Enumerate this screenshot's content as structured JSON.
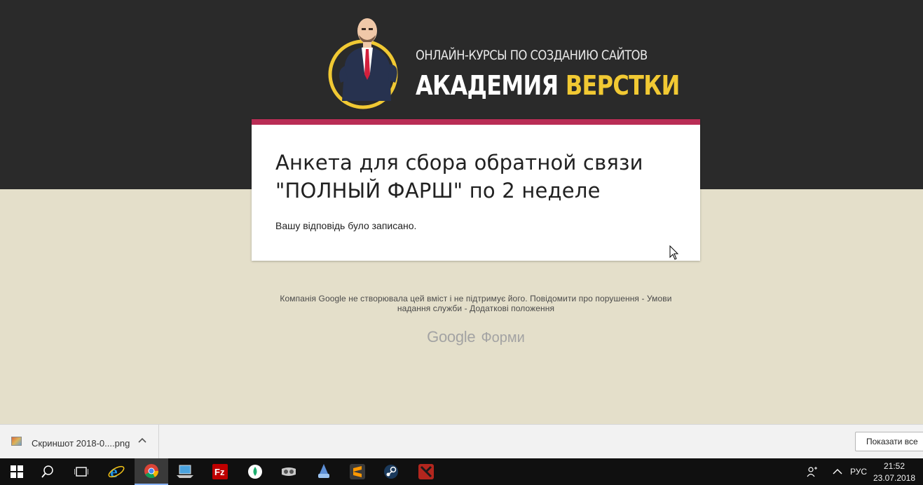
{
  "header": {
    "logo_subtitle": "ОНЛАЙН-КУРСЫ ПО СОЗДАНИЮ САЙТОВ",
    "logo_title_part1": "АКАДЕМИЯ",
    "logo_title_part2": "ВЕРСТКИ",
    "logo_accent_color": "#f1c933"
  },
  "form_card": {
    "title": "Анкета для сбора обратной связи \"ПОЛНЫЙ ФАРШ\" по 2 неделе",
    "confirmation": "Вашу відповідь було записано.",
    "accent_color": "#b92d55"
  },
  "footer": {
    "disclaimer": "Компанія Google не створювала цей вміст і не підтримує його. Повідомити про порушення - Умови надання служби - Додаткові положення",
    "brand_google": "Google",
    "brand_forms": "Форми"
  },
  "download_bar": {
    "file_name": "Скриншот 2018-0....png",
    "show_all_label": "Показати все"
  },
  "taskbar": {
    "apps": [
      "start-icon",
      "search-icon",
      "task-view-icon",
      "internet-explorer-icon",
      "chrome-icon",
      "computer-icon",
      "filezilla-icon",
      "app-green-icon",
      "vr-headset-icon",
      "wizard-icon",
      "sublime-text-icon",
      "steam-icon",
      "dota2-icon"
    ],
    "language": "РУС",
    "time": "21:52",
    "date": "23.07.2018"
  }
}
